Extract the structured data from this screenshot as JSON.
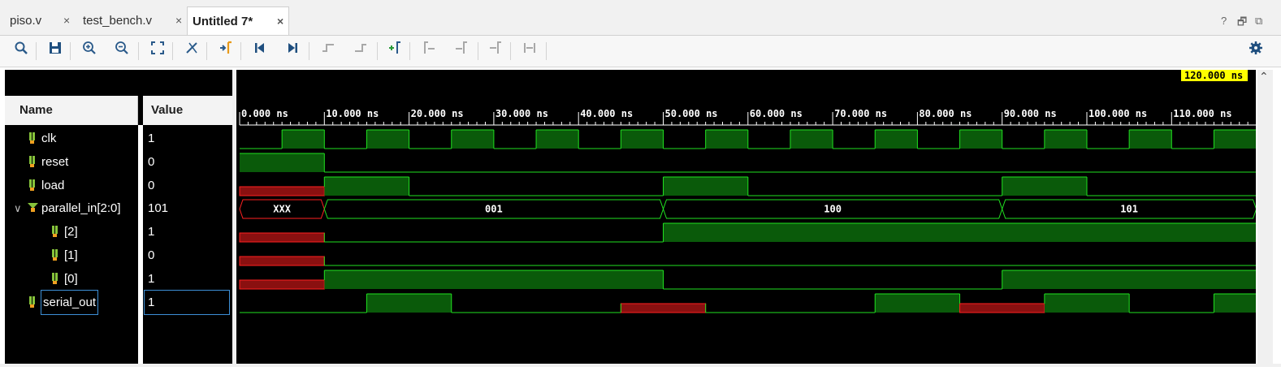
{
  "tabs": [
    {
      "label": "piso.v",
      "close": "×",
      "active": false
    },
    {
      "label": "test_bench.v",
      "close": "×",
      "active": false
    },
    {
      "label": "Untitled 7*",
      "close": "×",
      "active": true
    }
  ],
  "window_controls": {
    "help": "?",
    "restore": "🗗",
    "popout": "⧉"
  },
  "toolbar": {
    "icons": [
      "search-icon",
      "save-icon",
      "zoom-in-icon",
      "zoom-out-icon",
      "zoom-fit-icon",
      "cursor-remove-icon",
      "go-to-cursor-icon",
      "go-to-time-0-icon",
      "go-to-last-time-icon",
      "previous-transition-icon",
      "next-transition-icon",
      "add-marker-icon",
      "previous-marker-icon",
      "next-marker-icon",
      "swap-cursors-icon",
      "snap-to-transition-icon",
      "settings-icon"
    ]
  },
  "panel": {
    "name_header": "Name",
    "value_header": "Value"
  },
  "signals": [
    {
      "name": "clk",
      "value": "1",
      "type": "bit"
    },
    {
      "name": "reset",
      "value": "0",
      "type": "bit"
    },
    {
      "name": "load",
      "value": "0",
      "type": "bit"
    },
    {
      "name": "parallel_in[2:0]",
      "value": "101",
      "type": "bus",
      "expanded": true
    },
    {
      "name": "[2]",
      "value": "1",
      "type": "bit"
    },
    {
      "name": "[1]",
      "value": "0",
      "type": "bit"
    },
    {
      "name": "[0]",
      "value": "1",
      "type": "bit"
    },
    {
      "name": "serial_out",
      "value": "1",
      "type": "bit",
      "selected": true
    }
  ],
  "cursor": {
    "label": "120.000 ns",
    "time_ns": 120
  },
  "chart_data": {
    "type": "waveform",
    "time_unit": "ns",
    "x_range": [
      0,
      120
    ],
    "tick_labels": [
      "0.000 ns",
      "10.000 ns",
      "20.000 ns",
      "30.000 ns",
      "40.000 ns",
      "50.000 ns",
      "60.000 ns",
      "70.000 ns",
      "80.000 ns",
      "90.000 ns",
      "100.000 ns",
      "110.000 ns"
    ],
    "tick_times": [
      0,
      10,
      20,
      30,
      40,
      50,
      60,
      70,
      80,
      90,
      100,
      110
    ],
    "colors": {
      "high_fill": "#0a5a0a",
      "line": "#20e020",
      "unknown_fill": "#8a1010",
      "unknown_line": "#ff2020"
    },
    "traces": [
      {
        "signal": "clk",
        "kind": "bit",
        "segments": [
          {
            "t0": 0,
            "t1": 5,
            "v": "0"
          },
          {
            "t0": 5,
            "t1": 10,
            "v": "1"
          },
          {
            "t0": 10,
            "t1": 15,
            "v": "0"
          },
          {
            "t0": 15,
            "t1": 20,
            "v": "1"
          },
          {
            "t0": 20,
            "t1": 25,
            "v": "0"
          },
          {
            "t0": 25,
            "t1": 30,
            "v": "1"
          },
          {
            "t0": 30,
            "t1": 35,
            "v": "0"
          },
          {
            "t0": 35,
            "t1": 40,
            "v": "1"
          },
          {
            "t0": 40,
            "t1": 45,
            "v": "0"
          },
          {
            "t0": 45,
            "t1": 50,
            "v": "1"
          },
          {
            "t0": 50,
            "t1": 55,
            "v": "0"
          },
          {
            "t0": 55,
            "t1": 60,
            "v": "1"
          },
          {
            "t0": 60,
            "t1": 65,
            "v": "0"
          },
          {
            "t0": 65,
            "t1": 70,
            "v": "1"
          },
          {
            "t0": 70,
            "t1": 75,
            "v": "0"
          },
          {
            "t0": 75,
            "t1": 80,
            "v": "1"
          },
          {
            "t0": 80,
            "t1": 85,
            "v": "0"
          },
          {
            "t0": 85,
            "t1": 90,
            "v": "1"
          },
          {
            "t0": 90,
            "t1": 95,
            "v": "0"
          },
          {
            "t0": 95,
            "t1": 100,
            "v": "1"
          },
          {
            "t0": 100,
            "t1": 105,
            "v": "0"
          },
          {
            "t0": 105,
            "t1": 110,
            "v": "1"
          },
          {
            "t0": 110,
            "t1": 115,
            "v": "0"
          },
          {
            "t0": 115,
            "t1": 120,
            "v": "1"
          }
        ]
      },
      {
        "signal": "reset",
        "kind": "bit",
        "segments": [
          {
            "t0": 0,
            "t1": 10,
            "v": "1"
          },
          {
            "t0": 10,
            "t1": 120,
            "v": "0"
          }
        ]
      },
      {
        "signal": "load",
        "kind": "bit",
        "segments": [
          {
            "t0": 0,
            "t1": 10,
            "v": "x"
          },
          {
            "t0": 10,
            "t1": 20,
            "v": "1"
          },
          {
            "t0": 20,
            "t1": 50,
            "v": "0"
          },
          {
            "t0": 50,
            "t1": 60,
            "v": "1"
          },
          {
            "t0": 60,
            "t1": 90,
            "v": "0"
          },
          {
            "t0": 90,
            "t1": 100,
            "v": "1"
          },
          {
            "t0": 100,
            "t1": 120,
            "v": "0"
          }
        ]
      },
      {
        "signal": "parallel_in[2:0]",
        "kind": "bus",
        "segments": [
          {
            "t0": 0,
            "t1": 10,
            "v": "XXX",
            "unknown": true
          },
          {
            "t0": 10,
            "t1": 50,
            "v": "001"
          },
          {
            "t0": 50,
            "t1": 90,
            "v": "100"
          },
          {
            "t0": 90,
            "t1": 120,
            "v": "101"
          }
        ]
      },
      {
        "signal": "[2]",
        "kind": "bit",
        "segments": [
          {
            "t0": 0,
            "t1": 10,
            "v": "x"
          },
          {
            "t0": 10,
            "t1": 50,
            "v": "0"
          },
          {
            "t0": 50,
            "t1": 120,
            "v": "1"
          }
        ]
      },
      {
        "signal": "[1]",
        "kind": "bit",
        "segments": [
          {
            "t0": 0,
            "t1": 10,
            "v": "x"
          },
          {
            "t0": 10,
            "t1": 120,
            "v": "0"
          }
        ]
      },
      {
        "signal": "[0]",
        "kind": "bit",
        "segments": [
          {
            "t0": 0,
            "t1": 10,
            "v": "x"
          },
          {
            "t0": 10,
            "t1": 50,
            "v": "1"
          },
          {
            "t0": 50,
            "t1": 90,
            "v": "0"
          },
          {
            "t0": 90,
            "t1": 120,
            "v": "1"
          }
        ]
      },
      {
        "signal": "serial_out",
        "kind": "bit",
        "segments": [
          {
            "t0": 0,
            "t1": 15,
            "v": "0"
          },
          {
            "t0": 15,
            "t1": 25,
            "v": "1"
          },
          {
            "t0": 25,
            "t1": 45,
            "v": "0"
          },
          {
            "t0": 45,
            "t1": 55,
            "v": "x"
          },
          {
            "t0": 55,
            "t1": 75,
            "v": "0"
          },
          {
            "t0": 75,
            "t1": 85,
            "v": "1"
          },
          {
            "t0": 85,
            "t1": 95,
            "v": "x"
          },
          {
            "t0": 95,
            "t1": 105,
            "v": "1"
          },
          {
            "t0": 105,
            "t1": 115,
            "v": "0"
          },
          {
            "t0": 115,
            "t1": 120,
            "v": "1"
          }
        ]
      }
    ]
  }
}
